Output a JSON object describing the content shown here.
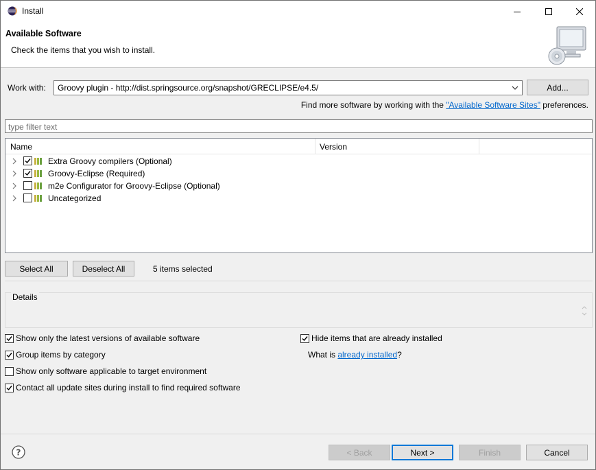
{
  "window": {
    "title": "Install",
    "minimize_symbol": "—",
    "maximize_symbol": "☐",
    "close_symbol": "✕"
  },
  "header": {
    "title": "Available Software",
    "description": "Check the items that you wish to install."
  },
  "work_with": {
    "label": "Work with:",
    "value": "Groovy plugin - http://dist.springsource.org/snapshot/GRECLIPSE/e4.5/",
    "add_button": "Add..."
  },
  "find_more": {
    "prefix": "Find more software by working with the ",
    "link": "\"Available Software Sites\"",
    "suffix": " preferences."
  },
  "filter": {
    "placeholder": "type filter text"
  },
  "tree": {
    "columns": [
      "Name",
      "Version"
    ],
    "items": [
      {
        "label": "Extra Groovy compilers (Optional)",
        "checked": true
      },
      {
        "label": "Groovy-Eclipse (Required)",
        "checked": true
      },
      {
        "label": "m2e Configurator for Groovy-Eclipse (Optional)",
        "checked": false
      },
      {
        "label": "Uncategorized",
        "checked": false
      }
    ]
  },
  "selection": {
    "select_all": "Select All",
    "deselect_all": "Deselect All",
    "count_text": "5 items selected"
  },
  "details": {
    "label": "Details"
  },
  "options": {
    "latest_versions": {
      "label": "Show only the latest versions of available software",
      "checked": true
    },
    "group_by_category": {
      "label": "Group items by category",
      "checked": true
    },
    "target_env": {
      "label": "Show only software applicable to target environment",
      "checked": false
    },
    "contact_sites": {
      "label": "Contact all update sites during install to find required software",
      "checked": true
    },
    "hide_installed": {
      "label": "Hide items that are already installed",
      "checked": true
    },
    "what_is_prefix": "What is ",
    "what_is_link": "already installed",
    "what_is_suffix": "?"
  },
  "footer": {
    "back": "< Back",
    "next": "Next >",
    "finish": "Finish",
    "cancel": "Cancel"
  },
  "icons": {
    "app": "eclipse-icon",
    "header_image": "install-cd-computer-icon",
    "help": "help-icon",
    "package": "feature-package-icon",
    "expand": "chevron-right-icon"
  },
  "colors": {
    "link": "#0066cc",
    "focus_border": "#0078d7",
    "dialog_bg": "#f0f0f0"
  }
}
